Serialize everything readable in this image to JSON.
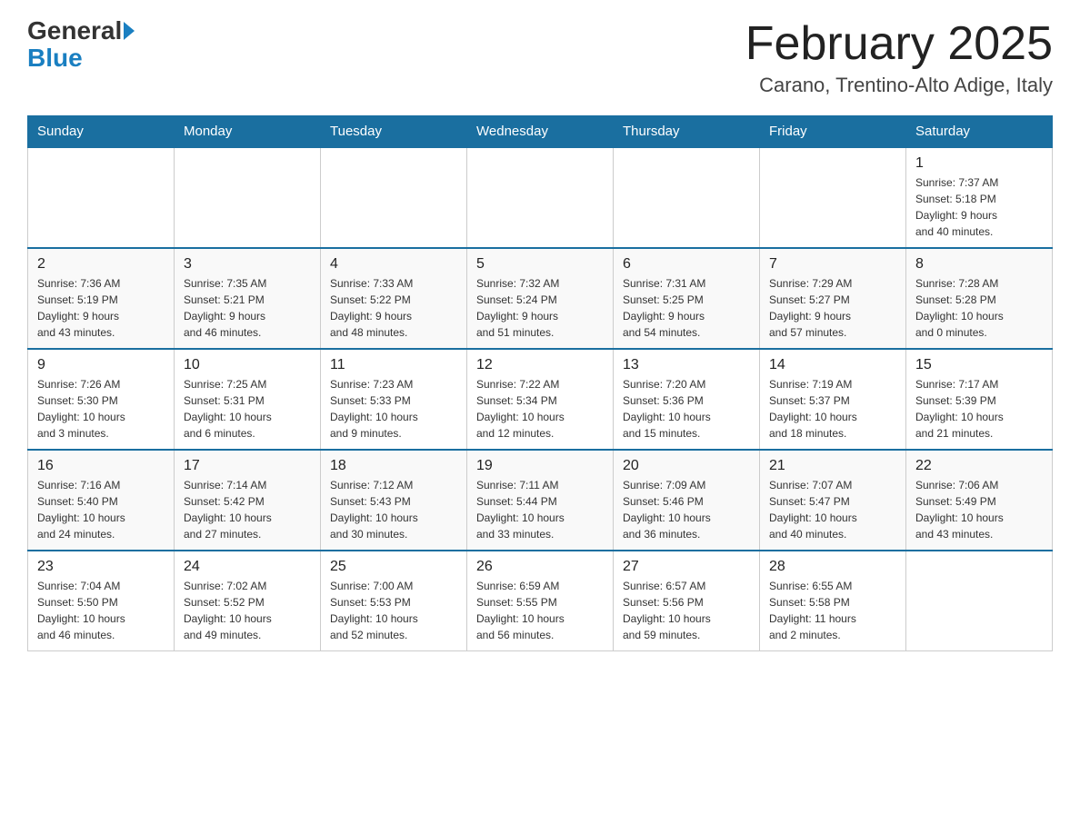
{
  "logo": {
    "top": "General",
    "bottom": "Blue"
  },
  "title": "February 2025",
  "subtitle": "Carano, Trentino-Alto Adige, Italy",
  "days_of_week": [
    "Sunday",
    "Monday",
    "Tuesday",
    "Wednesday",
    "Thursday",
    "Friday",
    "Saturday"
  ],
  "weeks": [
    [
      {
        "day": "",
        "info": ""
      },
      {
        "day": "",
        "info": ""
      },
      {
        "day": "",
        "info": ""
      },
      {
        "day": "",
        "info": ""
      },
      {
        "day": "",
        "info": ""
      },
      {
        "day": "",
        "info": ""
      },
      {
        "day": "1",
        "info": "Sunrise: 7:37 AM\nSunset: 5:18 PM\nDaylight: 9 hours\nand 40 minutes."
      }
    ],
    [
      {
        "day": "2",
        "info": "Sunrise: 7:36 AM\nSunset: 5:19 PM\nDaylight: 9 hours\nand 43 minutes."
      },
      {
        "day": "3",
        "info": "Sunrise: 7:35 AM\nSunset: 5:21 PM\nDaylight: 9 hours\nand 46 minutes."
      },
      {
        "day": "4",
        "info": "Sunrise: 7:33 AM\nSunset: 5:22 PM\nDaylight: 9 hours\nand 48 minutes."
      },
      {
        "day": "5",
        "info": "Sunrise: 7:32 AM\nSunset: 5:24 PM\nDaylight: 9 hours\nand 51 minutes."
      },
      {
        "day": "6",
        "info": "Sunrise: 7:31 AM\nSunset: 5:25 PM\nDaylight: 9 hours\nand 54 minutes."
      },
      {
        "day": "7",
        "info": "Sunrise: 7:29 AM\nSunset: 5:27 PM\nDaylight: 9 hours\nand 57 minutes."
      },
      {
        "day": "8",
        "info": "Sunrise: 7:28 AM\nSunset: 5:28 PM\nDaylight: 10 hours\nand 0 minutes."
      }
    ],
    [
      {
        "day": "9",
        "info": "Sunrise: 7:26 AM\nSunset: 5:30 PM\nDaylight: 10 hours\nand 3 minutes."
      },
      {
        "day": "10",
        "info": "Sunrise: 7:25 AM\nSunset: 5:31 PM\nDaylight: 10 hours\nand 6 minutes."
      },
      {
        "day": "11",
        "info": "Sunrise: 7:23 AM\nSunset: 5:33 PM\nDaylight: 10 hours\nand 9 minutes."
      },
      {
        "day": "12",
        "info": "Sunrise: 7:22 AM\nSunset: 5:34 PM\nDaylight: 10 hours\nand 12 minutes."
      },
      {
        "day": "13",
        "info": "Sunrise: 7:20 AM\nSunset: 5:36 PM\nDaylight: 10 hours\nand 15 minutes."
      },
      {
        "day": "14",
        "info": "Sunrise: 7:19 AM\nSunset: 5:37 PM\nDaylight: 10 hours\nand 18 minutes."
      },
      {
        "day": "15",
        "info": "Sunrise: 7:17 AM\nSunset: 5:39 PM\nDaylight: 10 hours\nand 21 minutes."
      }
    ],
    [
      {
        "day": "16",
        "info": "Sunrise: 7:16 AM\nSunset: 5:40 PM\nDaylight: 10 hours\nand 24 minutes."
      },
      {
        "day": "17",
        "info": "Sunrise: 7:14 AM\nSunset: 5:42 PM\nDaylight: 10 hours\nand 27 minutes."
      },
      {
        "day": "18",
        "info": "Sunrise: 7:12 AM\nSunset: 5:43 PM\nDaylight: 10 hours\nand 30 minutes."
      },
      {
        "day": "19",
        "info": "Sunrise: 7:11 AM\nSunset: 5:44 PM\nDaylight: 10 hours\nand 33 minutes."
      },
      {
        "day": "20",
        "info": "Sunrise: 7:09 AM\nSunset: 5:46 PM\nDaylight: 10 hours\nand 36 minutes."
      },
      {
        "day": "21",
        "info": "Sunrise: 7:07 AM\nSunset: 5:47 PM\nDaylight: 10 hours\nand 40 minutes."
      },
      {
        "day": "22",
        "info": "Sunrise: 7:06 AM\nSunset: 5:49 PM\nDaylight: 10 hours\nand 43 minutes."
      }
    ],
    [
      {
        "day": "23",
        "info": "Sunrise: 7:04 AM\nSunset: 5:50 PM\nDaylight: 10 hours\nand 46 minutes."
      },
      {
        "day": "24",
        "info": "Sunrise: 7:02 AM\nSunset: 5:52 PM\nDaylight: 10 hours\nand 49 minutes."
      },
      {
        "day": "25",
        "info": "Sunrise: 7:00 AM\nSunset: 5:53 PM\nDaylight: 10 hours\nand 52 minutes."
      },
      {
        "day": "26",
        "info": "Sunrise: 6:59 AM\nSunset: 5:55 PM\nDaylight: 10 hours\nand 56 minutes."
      },
      {
        "day": "27",
        "info": "Sunrise: 6:57 AM\nSunset: 5:56 PM\nDaylight: 10 hours\nand 59 minutes."
      },
      {
        "day": "28",
        "info": "Sunrise: 6:55 AM\nSunset: 5:58 PM\nDaylight: 11 hours\nand 2 minutes."
      },
      {
        "day": "",
        "info": ""
      }
    ]
  ]
}
